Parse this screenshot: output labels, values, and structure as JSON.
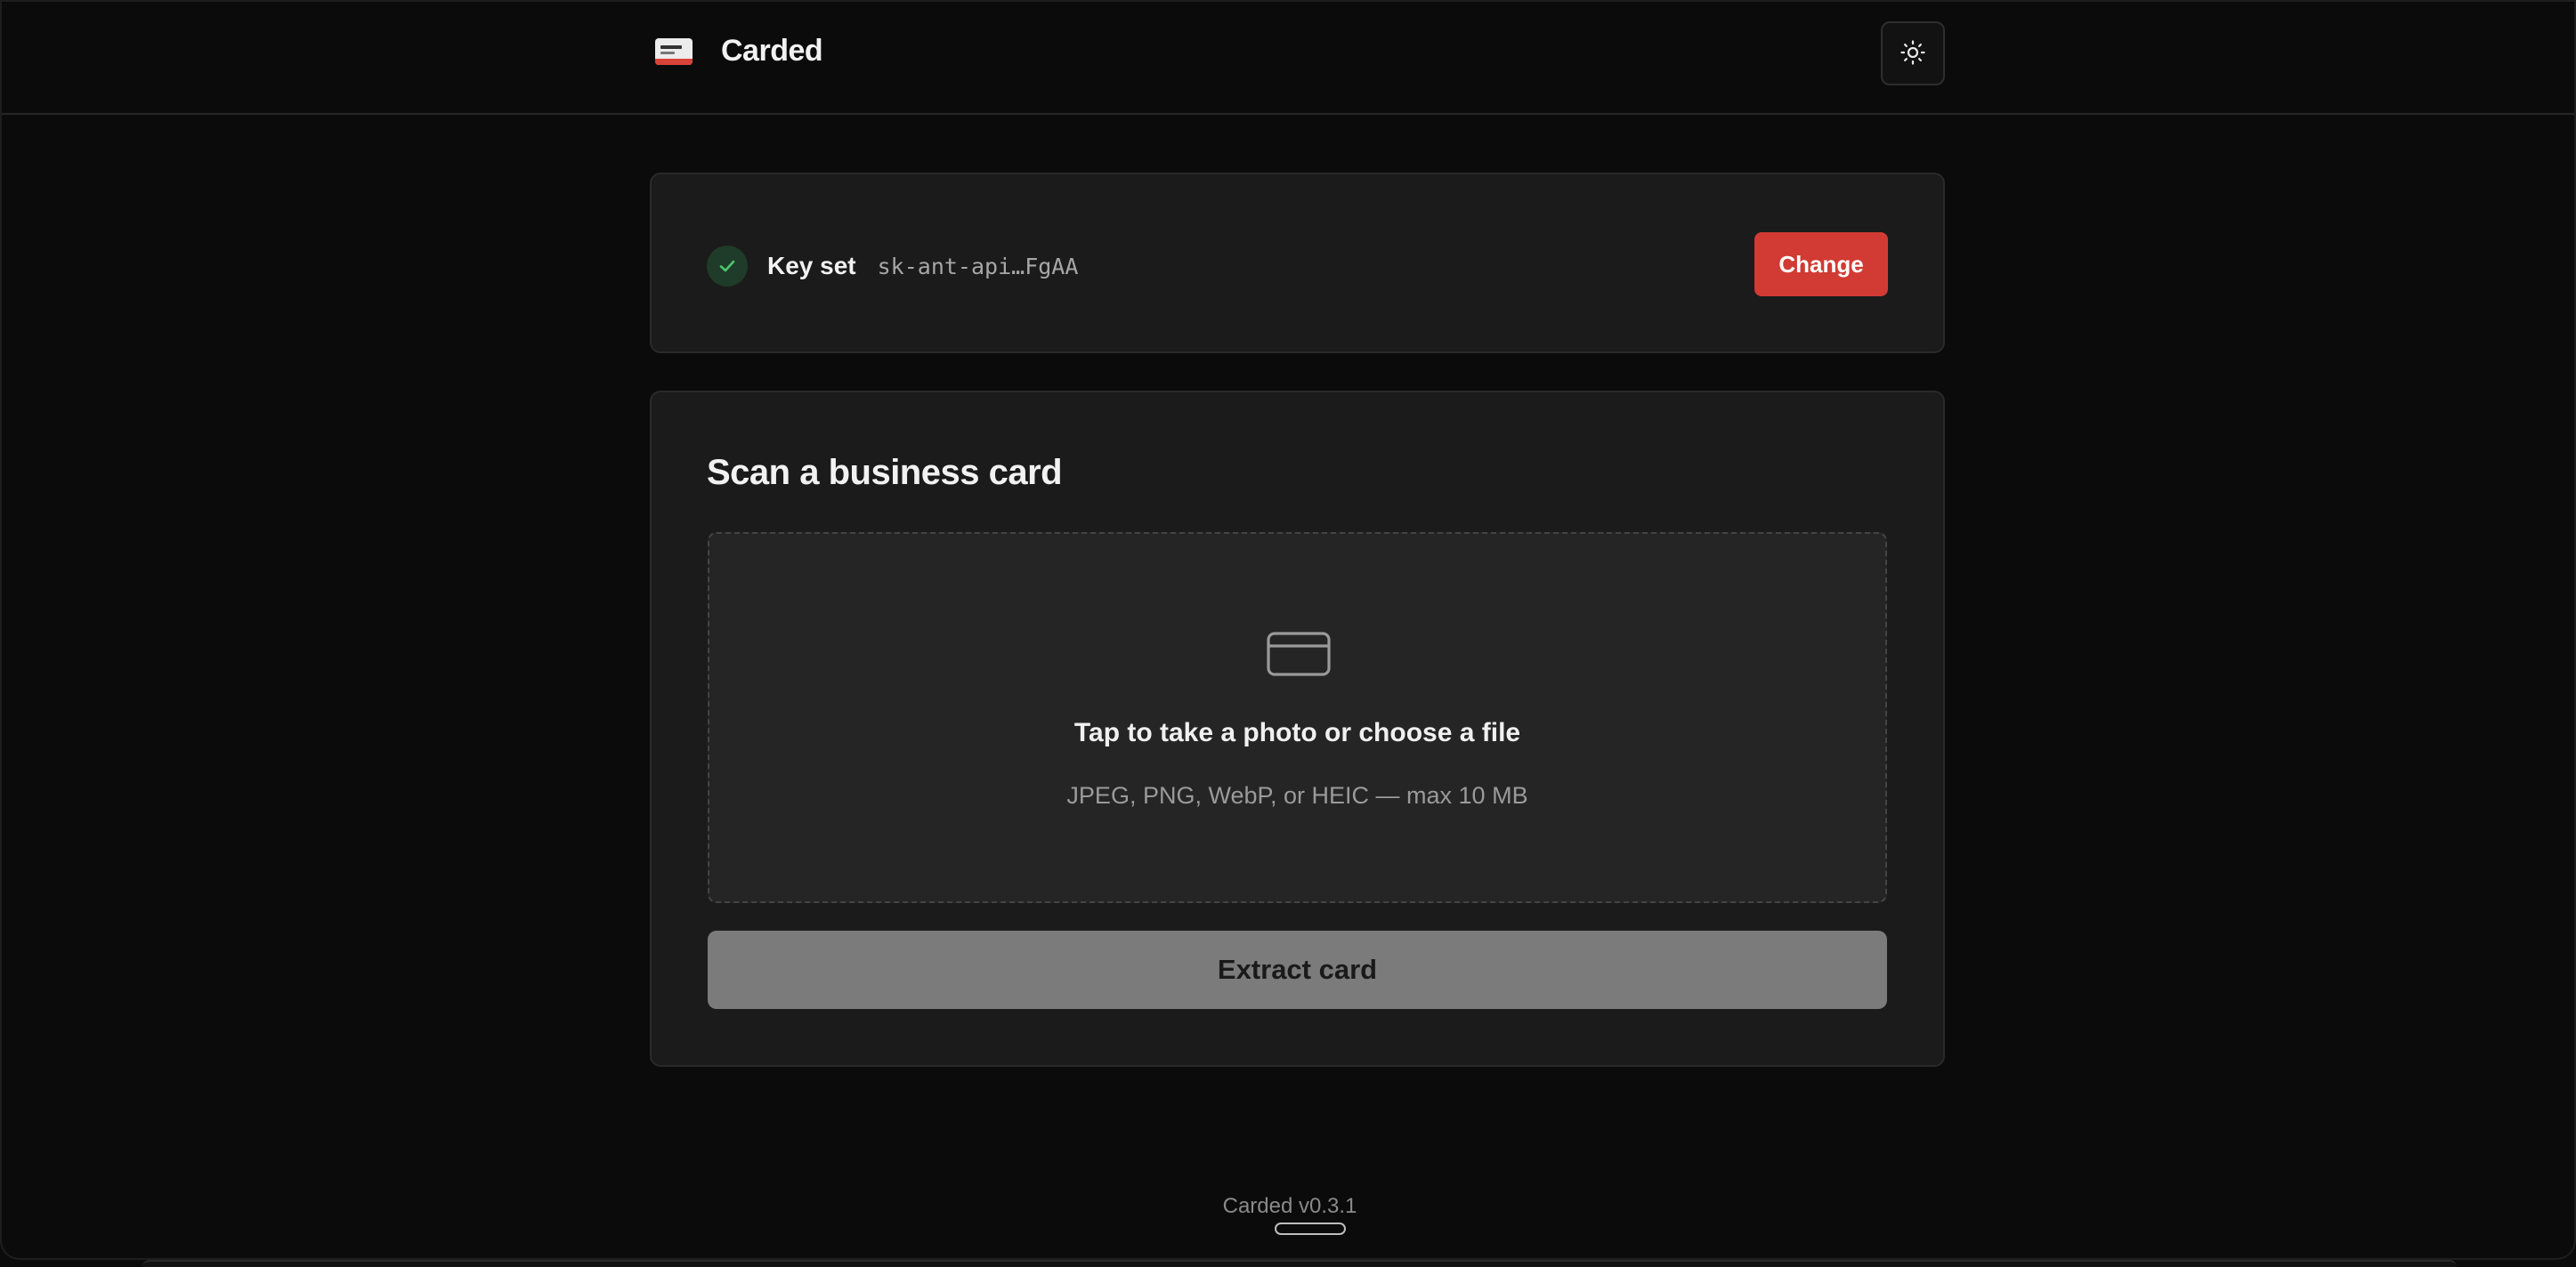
{
  "app": {
    "name": "Carded",
    "version_label": "Carded v0.3.1"
  },
  "header": {
    "logo_icon": "business-card-logo-icon",
    "theme_toggle_icon": "sun-icon"
  },
  "api_key": {
    "status_label": "Key set",
    "masked_value": "sk-ant-api…FgAA",
    "change_label": "Change",
    "status_color": "#4cc76e",
    "accent_color": "#d13b33"
  },
  "scan": {
    "title": "Scan a business card",
    "dropzone_icon": "credit-card-icon",
    "dropzone_title": "Tap to take a photo or choose a file",
    "dropzone_hint": "JPEG, PNG, WebP, or HEIC — max 10 MB",
    "extract_label": "Extract card",
    "extract_disabled": true
  }
}
